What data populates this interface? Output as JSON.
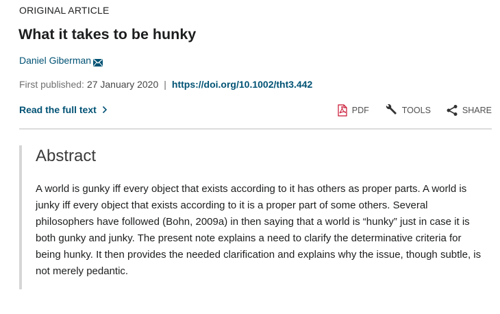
{
  "article": {
    "type": "ORIGINAL ARTICLE",
    "title": "What it takes to be hunky",
    "author": "Daniel Giberman",
    "published_label": "First published:",
    "published_date": "27 January 2020",
    "separator": "|",
    "doi": "https://doi.org/10.1002/tht3.442",
    "read_full_text": "Read the full text"
  },
  "actions": {
    "pdf_label": "PDF",
    "tools_label": "TOOLS",
    "share_label": "SHARE"
  },
  "icons": [
    "email-icon",
    "chevron-right-icon",
    "pdf-icon",
    "wrench-icon",
    "share-icon"
  ],
  "colors": {
    "link": "#005274",
    "text": "#1c1d1e",
    "muted": "#707070",
    "pdf_red": "#c8102e",
    "rule": "#dcdcdc"
  },
  "abstract": {
    "heading": "Abstract",
    "text": "A world is gunky iff every object that exists according to it has others as proper parts. A world is junky iff every object that exists according to it is a proper part of some others. Several philosophers have followed (Bohn, 2009a) in then saying that a world is “hunky” just in case it is both gunky and junky. The present note explains a need to clarify the determinative criteria for being hunky. It then provides the needed clarification and explains why the issue, though subtle, is not merely pedantic."
  }
}
